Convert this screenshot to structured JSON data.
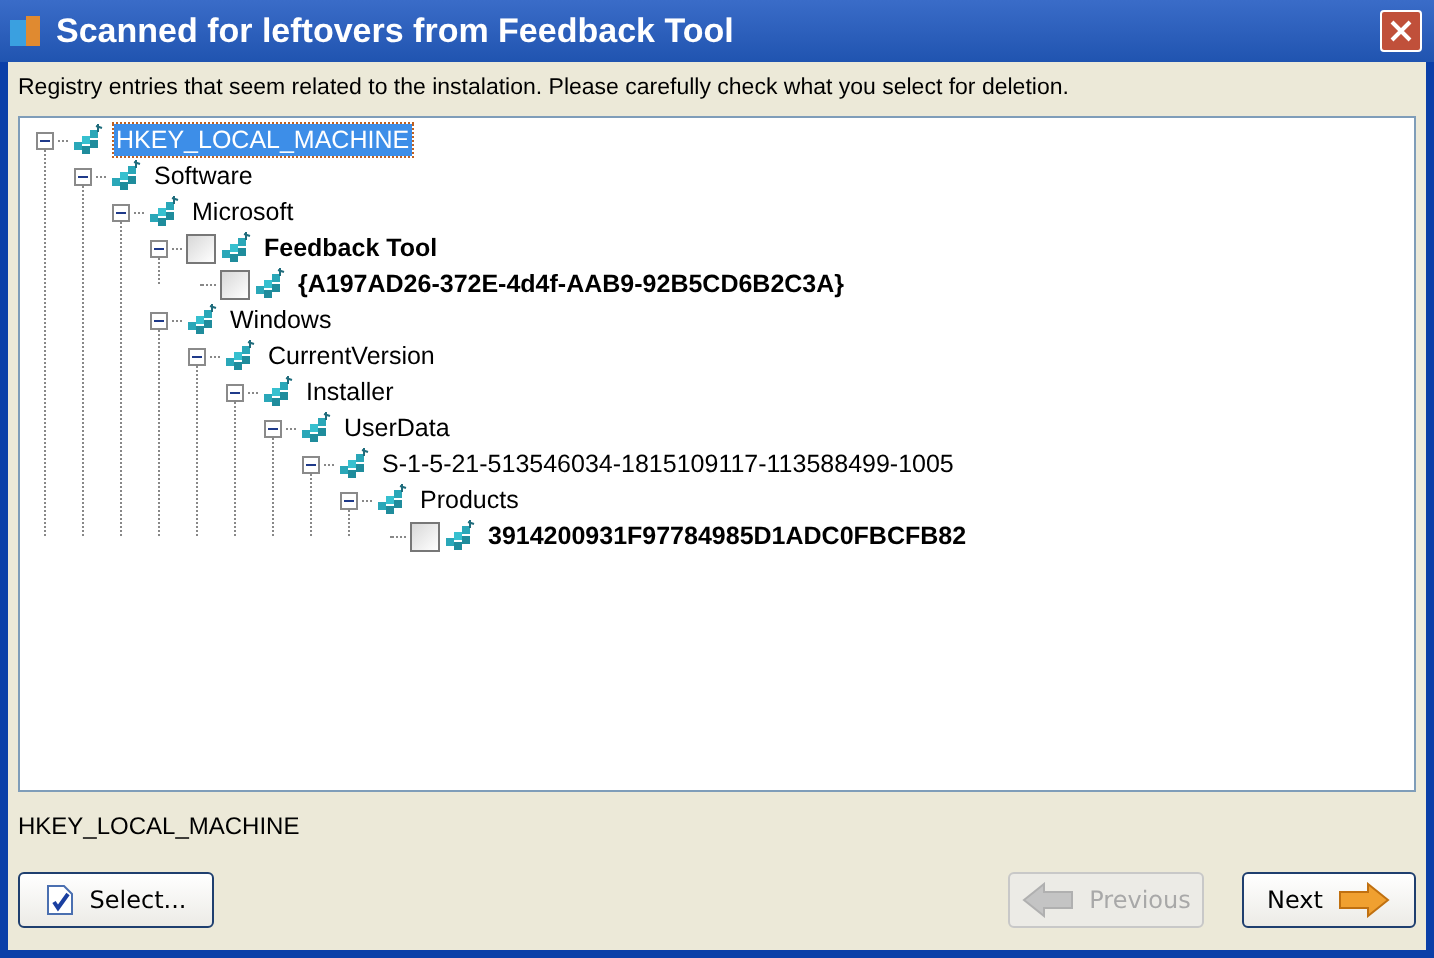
{
  "window": {
    "title": "Scanned for leftovers from Feedback Tool"
  },
  "instructions": "Registry entries that seem related to the instalation. Please carefully check what you select for deletion.",
  "tree": [
    {
      "label": "HKEY_LOCAL_MACHINE",
      "kind": "key",
      "selected": true,
      "expanded": true,
      "children": [
        {
          "label": "Software",
          "kind": "key",
          "selected": false,
          "expanded": true,
          "children": [
            {
              "label": "Microsoft",
              "kind": "key",
              "selected": false,
              "expanded": true,
              "children": [
                {
                  "label": "Feedback Tool",
                  "kind": "checkable",
                  "checked": false,
                  "selected": false,
                  "expanded": true,
                  "children": [
                    {
                      "label": "{A197AD26-372E-4d4f-AAB9-92B5CD6B2C3A}",
                      "kind": "checkable",
                      "checked": false,
                      "selected": false
                    }
                  ]
                },
                {
                  "label": "Windows",
                  "kind": "key",
                  "selected": false,
                  "expanded": true,
                  "children": [
                    {
                      "label": "CurrentVersion",
                      "kind": "key",
                      "selected": false,
                      "expanded": true,
                      "children": [
                        {
                          "label": "Installer",
                          "kind": "key",
                          "selected": false,
                          "expanded": true,
                          "children": [
                            {
                              "label": "UserData",
                              "kind": "key",
                              "selected": false,
                              "expanded": true,
                              "children": [
                                {
                                  "label": "S-1-5-21-513546034-1815109117-113588499-1005",
                                  "kind": "key",
                                  "selected": false,
                                  "expanded": true,
                                  "children": [
                                    {
                                      "label": "Products",
                                      "kind": "key",
                                      "selected": false,
                                      "expanded": true,
                                      "children": [
                                        {
                                          "label": "3914200931F97784985D1ADC0FBCFB82",
                                          "kind": "checkable",
                                          "checked": false,
                                          "selected": false
                                        }
                                      ]
                                    }
                                  ]
                                }
                              ]
                            }
                          ]
                        }
                      ]
                    }
                  ]
                }
              ]
            }
          ]
        }
      ]
    }
  ],
  "status": "HKEY_LOCAL_MACHINE",
  "buttons": [
    {
      "label": "Select...",
      "kind": "select",
      "disabled": false
    },
    {
      "label": "Previous",
      "kind": "previous",
      "disabled": true
    },
    {
      "label": "Next",
      "kind": "next",
      "disabled": false
    }
  ]
}
